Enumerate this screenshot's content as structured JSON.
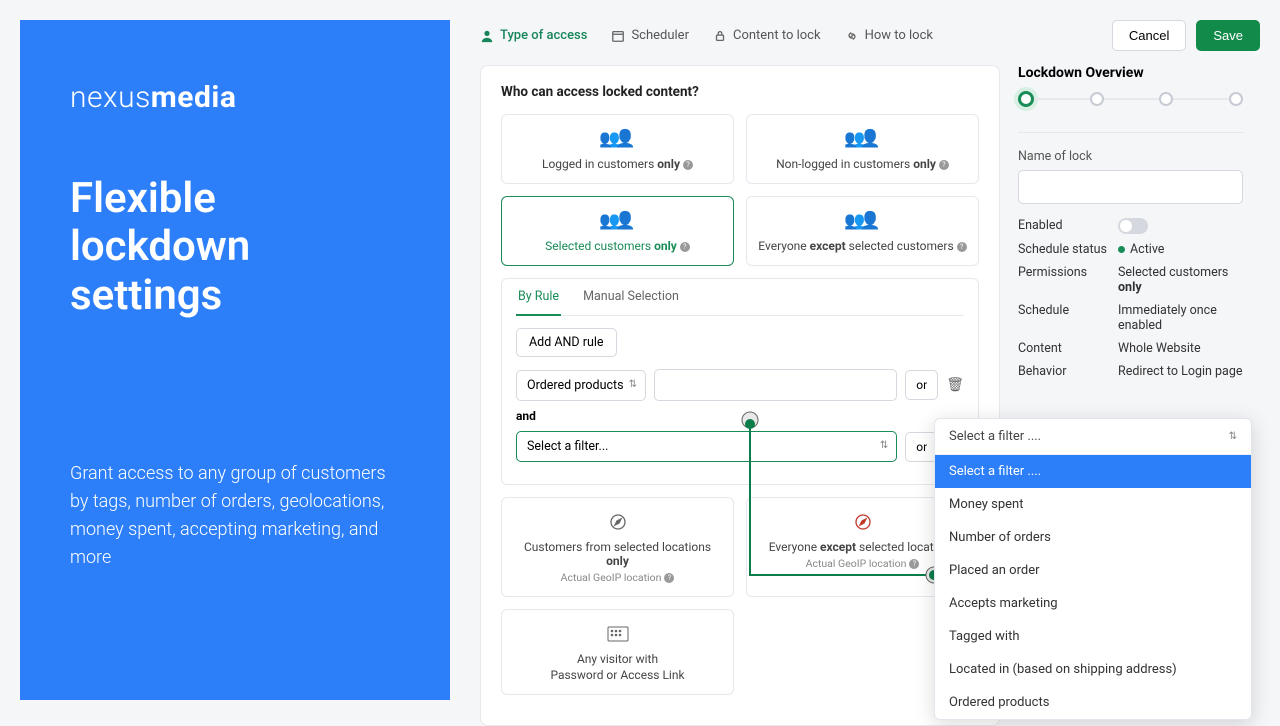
{
  "left": {
    "logo_light": "nexus",
    "logo_bold": "media",
    "headline": "Flexible lockdown settings",
    "subtext": "Grant access to any group of customers by tags, number of orders, geolocations, money spent, accepting marketing, and more"
  },
  "tabs": {
    "type_of_access": "Type of access",
    "scheduler": "Scheduler",
    "content_to_lock": "Content to lock",
    "how_to_lock": "How to lock"
  },
  "actions": {
    "cancel": "Cancel",
    "save": "Save"
  },
  "question": "Who can access locked content?",
  "cards": {
    "logged_in_pre": "Logged in customers ",
    "logged_in_bold": "only",
    "non_logged_pre": "Non-logged in customers ",
    "non_logged_bold": "only",
    "selected_pre": "Selected customers ",
    "selected_bold": "only",
    "everyone_pre": "Everyone ",
    "everyone_bold": "except",
    "everyone_post": " selected customers",
    "loc_sel_pre": "Customers from selected locations ",
    "loc_sel_bold": "only",
    "loc_every_pre": "Everyone ",
    "loc_every_bold": "except",
    "loc_every_post": " selected locations",
    "geoip_sub": "Actual GeoIP location",
    "visitor_l1": "Any visitor with",
    "visitor_l2": "Password or Access Link"
  },
  "subtabs": {
    "by_rule": "By Rule",
    "manual": "Manual Selection"
  },
  "rules": {
    "add_and": "Add AND rule",
    "ordered_products": "Ordered products",
    "or": "or",
    "and": "and",
    "select_filter": "Select a filter..."
  },
  "overview": {
    "title": "Lockdown Overview",
    "name_label": "Name of lock",
    "enabled": "Enabled",
    "schedule_status_k": "Schedule status",
    "schedule_status_v": "Active",
    "permissions_k": "Permissions",
    "permissions_v_pre": "Selected customers ",
    "permissions_v_bold": "only",
    "schedule_k": "Schedule",
    "schedule_v": "Immediately once enabled",
    "content_k": "Content",
    "content_v": "Whole Website",
    "behavior_k": "Behavior",
    "behavior_v": "Redirect to Login page"
  },
  "dropdown": {
    "header": "Select a filter ....",
    "opt_select": "Select a filter ....",
    "opt_money": "Money spent",
    "opt_orders": "Number of orders",
    "opt_placed": "Placed an order",
    "opt_marketing": "Accepts marketing",
    "opt_tagged": "Tagged with",
    "opt_located": "Located in (based on shipping address)",
    "opt_ordered": "Ordered products"
  }
}
